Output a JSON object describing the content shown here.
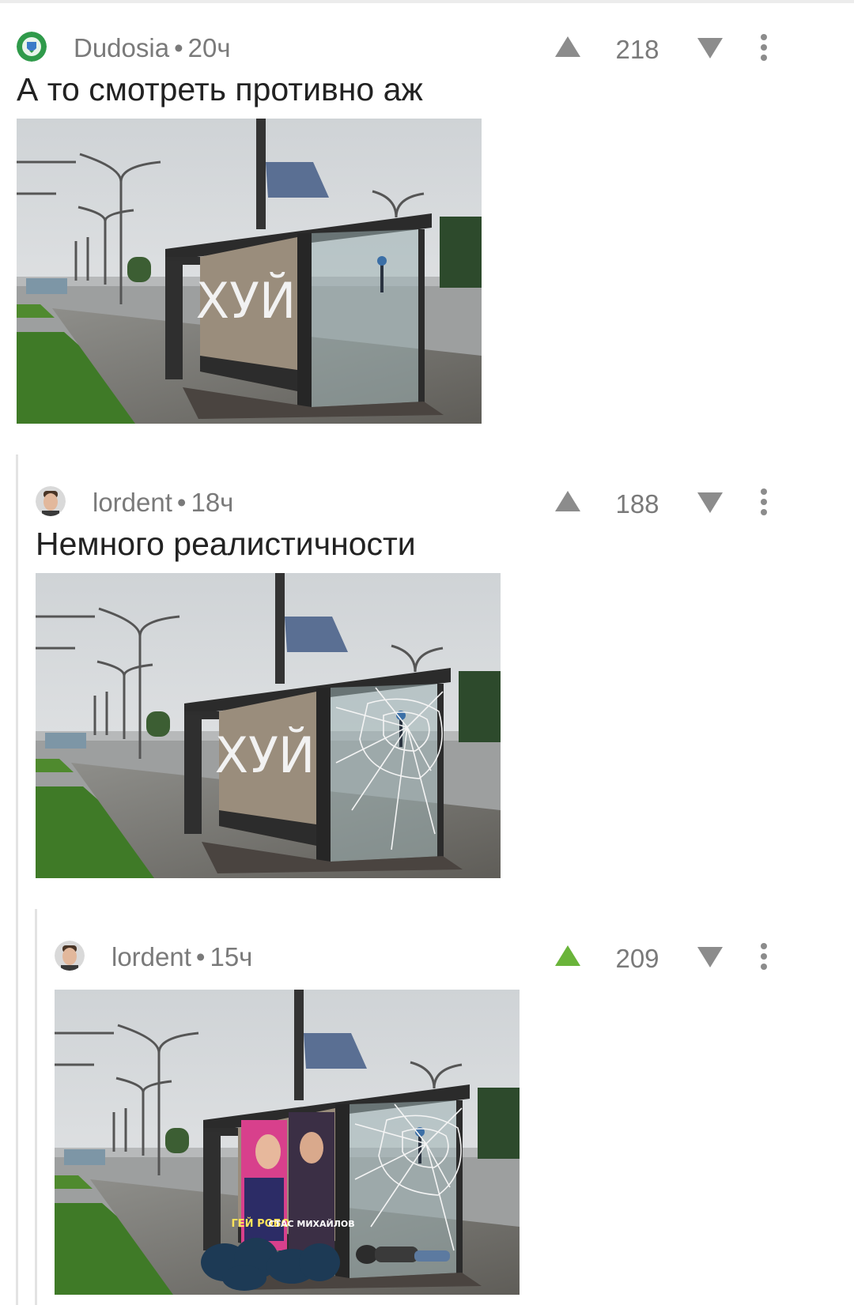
{
  "comments": [
    {
      "author": "Dudosia",
      "time": "20ч",
      "score": "218",
      "text": "А то смотреть противно аж",
      "upvote_active": false,
      "graffiti": "ХУЙ"
    },
    {
      "author": "lordent",
      "time": "18ч",
      "score": "188",
      "text": "Немного реалистичности",
      "upvote_active": false,
      "graffiti": "ХУЙ"
    },
    {
      "author": "lordent",
      "time": "15ч",
      "score": "209",
      "upvote_active": true,
      "poster_left": "ГЕЙ РОБОТ",
      "poster_right": "СТАС МИХАЙЛОВ"
    }
  ],
  "colors": {
    "arrow_default": "#8c8c8c",
    "arrow_active": "#6ab43a",
    "meta_text": "#7a7a7a"
  },
  "icons": [
    "upvote-icon",
    "downvote-icon",
    "more-options-icon"
  ]
}
